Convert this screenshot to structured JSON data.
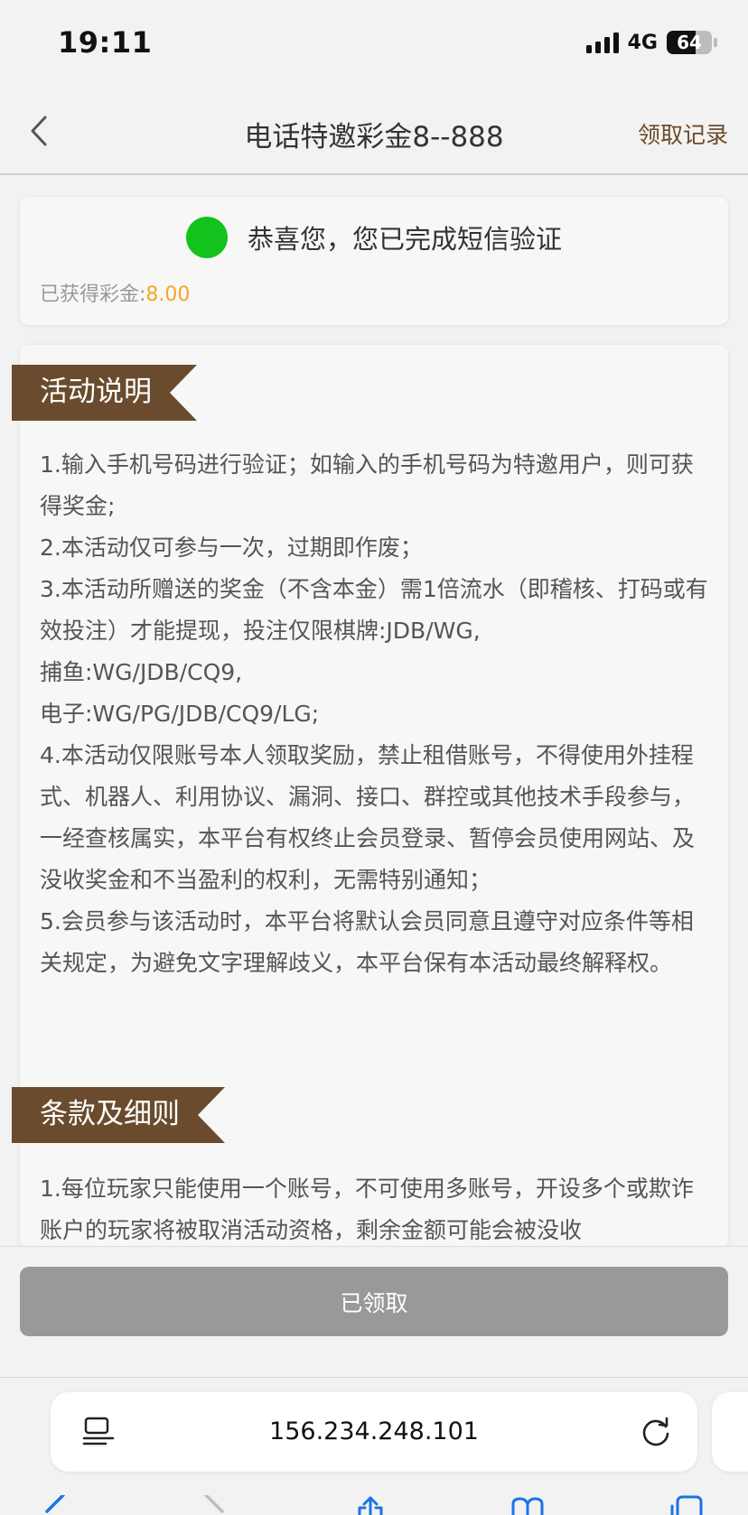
{
  "status": {
    "time": "19:11",
    "network": "4G",
    "battery": "64",
    "battery_level": 0.64
  },
  "nav": {
    "title": "电话特邀彩金8--888",
    "record_label": "领取记录",
    "back_icon": "chevron-left-icon"
  },
  "success": {
    "message": "恭喜您，您已完成短信验证",
    "bonus_label": "已获得彩金:",
    "bonus_value": "8.00",
    "dot_color": "#12c21d",
    "bonus_color": "#f5a623"
  },
  "rules": {
    "section1_title": "活动说明",
    "section1_items": [
      "1.输入手机号码进行验证；如输入的手机号码为特邀用户，则可获得奖金;",
      "2.本活动仅可参与一次，过期即作废；",
      "3.本活动所赠送的奖金（不含本金）需1倍流水（即稽核、打码或有效投注）才能提现，投注仅限棋牌:JDB/WG,",
      "捕鱼:WG/JDB/CQ9,",
      "电子:WG/PG/JDB/CQ9/LG;",
      "4.本活动仅限账号本人领取奖励，禁止租借账号，不得使用外挂程式、机器人、利用协议、漏洞、接口、群控或其他技术手段参与，一经查核属实，本平台有权终止会员登录、暂停会员使用网站、及没收奖金和不当盈利的权利，无需特别通知；",
      "5.会员参与该活动时，本平台将默认会员同意且遵守对应条件等相关规定，为避免文字理解歧义，本平台保有本活动最终解释权。"
    ],
    "section2_title": "条款及细则",
    "section2_items": [
      "1.每位玩家只能使用一个账号，不可使用多账号，开设多个或欺诈账户的玩家将被取消活动资格，剩余金额可能会被没收"
    ],
    "ribbon_color": "#6a4b2e"
  },
  "claim": {
    "button_label": "已领取"
  },
  "browser": {
    "url": "156.234.248.101",
    "menu_icon": "page-menu-icon",
    "reload_icon": "reload-icon"
  }
}
